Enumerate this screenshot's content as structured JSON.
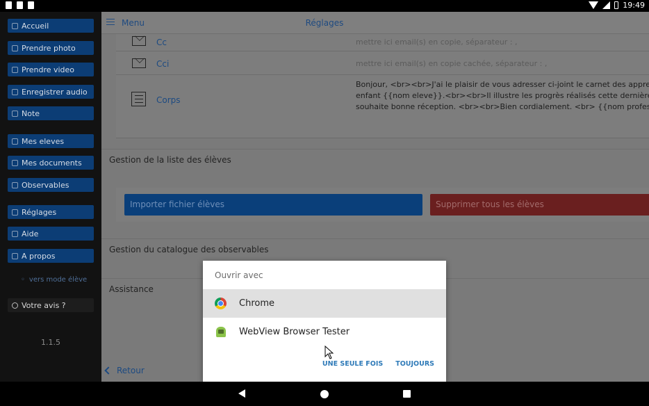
{
  "status_bar": {
    "time": "19:49"
  },
  "sidebar": {
    "items": [
      {
        "label": "Accueil",
        "icon": "home-icon"
      },
      {
        "label": "Prendre photo",
        "icon": "camera-icon"
      },
      {
        "label": "Prendre video",
        "icon": "video-icon"
      },
      {
        "label": "Enregistrer audio",
        "icon": "mic-icon"
      },
      {
        "label": "Note",
        "icon": "note-icon"
      },
      {
        "label": "Mes eleves",
        "icon": "group-icon"
      },
      {
        "label": "Mes documents",
        "icon": "folder-icon"
      },
      {
        "label": "Observables",
        "icon": "bookmark-icon"
      },
      {
        "label": "Réglages",
        "icon": "gear-icon"
      },
      {
        "label": "Aide",
        "icon": "help-icon"
      },
      {
        "label": "A propos",
        "icon": "info-icon"
      }
    ],
    "mode_link": "vers mode élève",
    "feedback": "Votre avis ?",
    "version": "1.1.5"
  },
  "header": {
    "menu_label": "Menu",
    "title": "Réglages"
  },
  "email_fields": {
    "cc": {
      "label": "Cc",
      "placeholder": "mettre ici email(s) en copie, séparateur : ,"
    },
    "cci": {
      "label": "Cci",
      "placeholder": "mettre ici email(s) en copie cachée, séparateur : ,"
    },
    "corps": {
      "label": "Corps",
      "lines": [
        "Bonjour, <br><br>J'ai le plaisir de vous adresser ci-joint le carnet des apprenti",
        "enfant {{nom eleve}}.<br><br>Il illustre les progrès réalisés cette dernière péri",
        "souhaite bonne réception. <br><br>Bien cordialement. <br> {{nom professeur"
      ]
    }
  },
  "sections": {
    "students": "Gestion de la liste des élèves",
    "import_button": "Importer fichier élèves",
    "delete_button": "Supprimer tous les élèves",
    "catalog": "Gestion du catalogue des observables",
    "assistance": "Assistance"
  },
  "footer": {
    "back_label": "Retour"
  },
  "dialog": {
    "title": "Ouvrir avec",
    "apps": [
      {
        "label": "Chrome",
        "icon": "chrome-icon",
        "selected": true
      },
      {
        "label": "WebView Browser Tester",
        "icon": "android-icon",
        "selected": false
      }
    ],
    "once_label": "UNE SEULE FOIS",
    "always_label": "TOUJOURS"
  },
  "colors": {
    "accent": "#0a3f7a",
    "danger": "#6a1f1f",
    "dialog_action": "#2e7ab8"
  }
}
